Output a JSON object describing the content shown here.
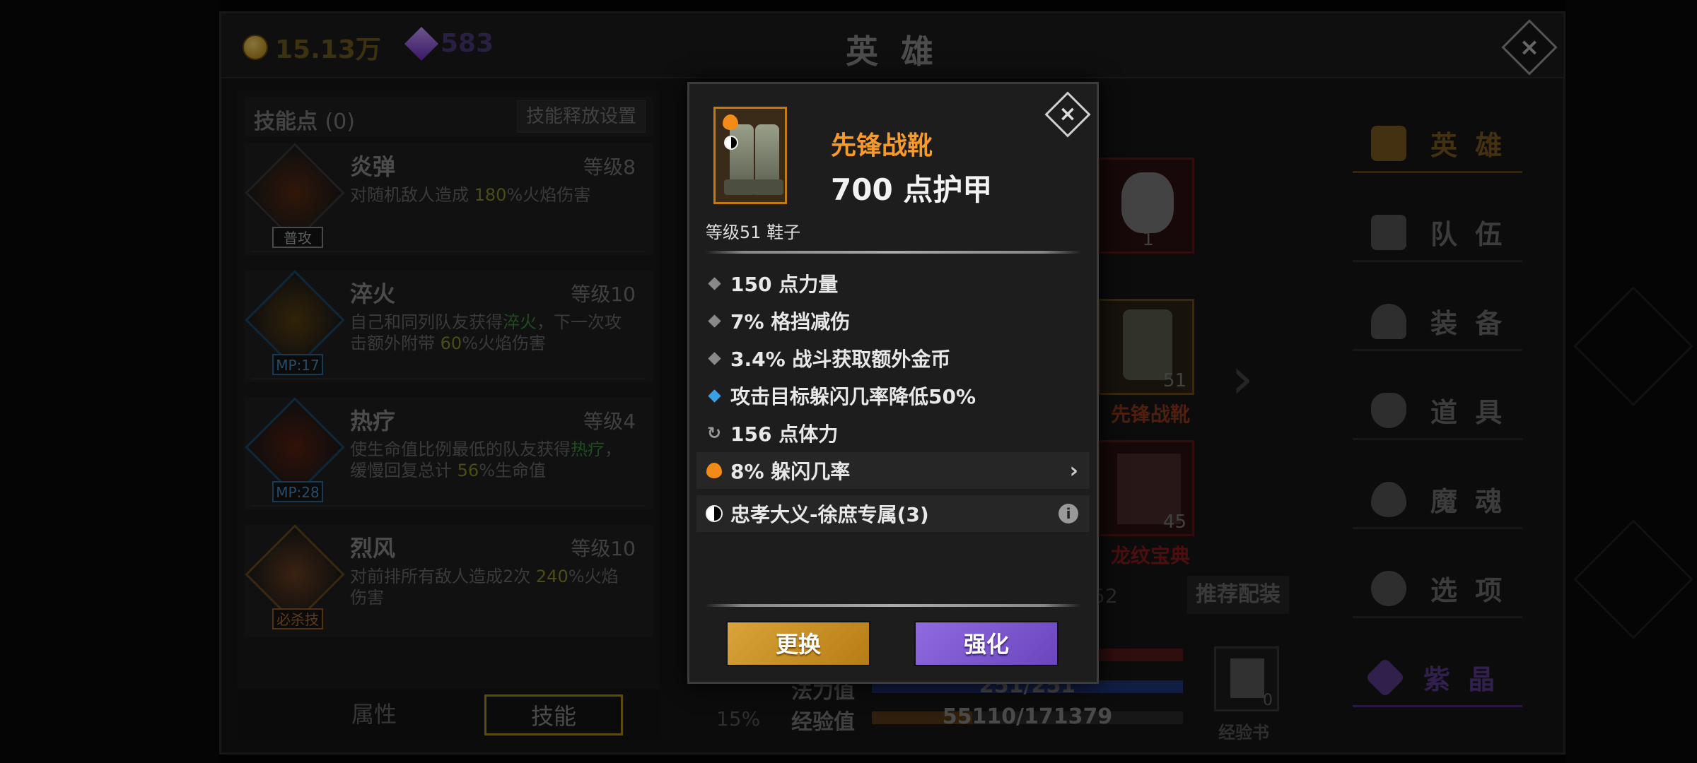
{
  "header": {
    "gold": "15.13万",
    "gems": "583",
    "title": "英 雄"
  },
  "skills_panel": {
    "title": "技能点",
    "points": "(0)",
    "release_button": "技能释放设置",
    "skills": [
      {
        "name": "炎弹",
        "level": "等级8",
        "tag": "普攻",
        "desc_parts": [
          "对随机敌人造成 ",
          "180",
          "%火焰伤害",
          "",
          "",
          ""
        ]
      },
      {
        "name": "淬火",
        "level": "等级10",
        "tag": "MP:17",
        "desc_parts": [
          "自己和同列队友获得",
          "淬火",
          "，下一次攻击额外附带 ",
          "60",
          "%火焰伤害",
          ""
        ]
      },
      {
        "name": "热疗",
        "level": "等级4",
        "tag": "MP:28",
        "desc_parts": [
          "使生命值比例最低的队友获得",
          "热疗",
          "，缓慢回复总计 ",
          "56",
          "%生命值",
          ""
        ]
      },
      {
        "name": "烈风",
        "level": "等级10",
        "tag": "必杀技",
        "desc_parts": [
          "对前排所有敌人造成2次 ",
          "240",
          "%火焰伤害",
          "",
          "",
          ""
        ]
      }
    ]
  },
  "bottom_tabs": {
    "attributes": "属性",
    "skills": "技能"
  },
  "sidebar": {
    "items": [
      "英 雄",
      "队 伍",
      "装 备",
      "道 具",
      "魔 魂",
      "选 项",
      "紫 晶"
    ]
  },
  "equipment": {
    "slot1_num": "1",
    "slot2_num": "51",
    "slot2_name": "先锋战靴",
    "slot3_num": "45",
    "slot3_name": "龙纹宝典",
    "recommend": "推荐配装",
    "partial_num": "52",
    "exp_book_num": "0",
    "exp_book_label": "经验书"
  },
  "stats": {
    "mana_label": "法力值",
    "mana_value": "251/251",
    "exp_label": "经验值",
    "exp_value": "55110/171379",
    "exp_fraction": 0.3216,
    "mana_fraction": 1.0,
    "percent": "15%"
  },
  "modal": {
    "item_name": "先锋战靴",
    "armor": "700 点护甲",
    "level_type": "等级51 鞋子",
    "attrs": [
      {
        "text": "150 点力量",
        "bullet": "diamond"
      },
      {
        "text": "7% 格挡减伤",
        "bullet": "diamond"
      },
      {
        "text": "3.4% 战斗获取额外金币",
        "bullet": "diamond"
      },
      {
        "text": "攻击目标躲闪几率降低50%",
        "bullet": "diamond-blue"
      },
      {
        "text": "156 点体力",
        "bullet": "refresh-icon"
      },
      {
        "text": "8% 躲闪几率",
        "bullet": "flame-icon"
      },
      {
        "text": "忠孝大义-徐庶专属(3)",
        "bullet": "yinyang-icon"
      }
    ],
    "replace_button": "更换",
    "enhance_button": "强化",
    "close_symbol": "×"
  },
  "window": {
    "close_symbol": "×"
  },
  "colors": {
    "gold_text": "#7a5a20",
    "gem_text": "#4a2f7a",
    "item_name": "#f59a2b",
    "replace_btn": "#d9a43a",
    "enhance_btn": "#8f6ae0"
  }
}
